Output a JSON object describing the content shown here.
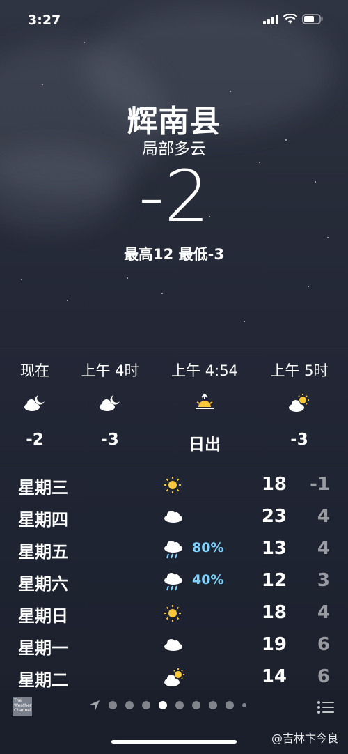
{
  "status_bar": {
    "time": "3:27"
  },
  "header": {
    "city": "辉南县",
    "condition": "局部多云",
    "temperature": "-2",
    "high_low": "最高12  最低-3"
  },
  "hourly": [
    {
      "label": "现在",
      "icon": "partly-cloudy-night-icon",
      "value": "-2"
    },
    {
      "label": "上午 4时",
      "icon": "partly-cloudy-night-icon",
      "value": "-3"
    },
    {
      "label": "上午 4:54",
      "icon": "sunrise-icon",
      "value": "日出"
    },
    {
      "label": "上午 5时",
      "icon": "partly-sunny-icon",
      "value": "-3"
    }
  ],
  "daily": [
    {
      "day": "星期三",
      "icon": "sun-icon",
      "pct": "",
      "high": "18",
      "low": "-1"
    },
    {
      "day": "星期四",
      "icon": "cloud-icon",
      "pct": "",
      "high": "23",
      "low": "4"
    },
    {
      "day": "星期五",
      "icon": "rain-cloud-icon",
      "pct": "80%",
      "high": "13",
      "low": "4"
    },
    {
      "day": "星期六",
      "icon": "rain-cloud-icon",
      "pct": "40%",
      "high": "12",
      "low": "3"
    },
    {
      "day": "星期日",
      "icon": "sun-icon",
      "pct": "",
      "high": "18",
      "low": "4"
    },
    {
      "day": "星期一",
      "icon": "cloud-icon",
      "pct": "",
      "high": "19",
      "low": "6"
    },
    {
      "day": "星期二",
      "icon": "partly-sunny-icon",
      "pct": "",
      "high": "14",
      "low": "6"
    }
  ],
  "bottom_bar": {
    "logo_text": "The Weather Channel",
    "watermark": "@吉林卞今良"
  },
  "colors": {
    "precip": "#7fd4ff",
    "sun": "#f7c83a",
    "background": "#232736"
  }
}
